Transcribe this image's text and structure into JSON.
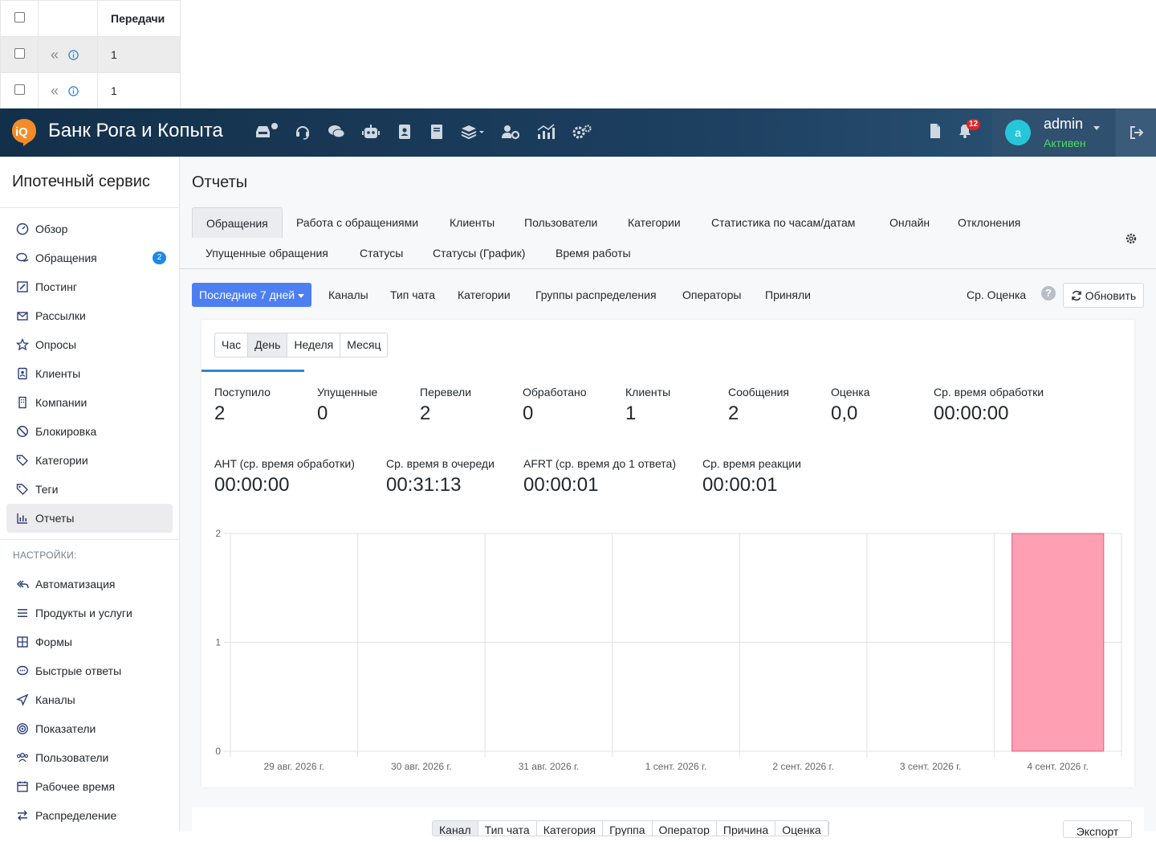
{
  "mini_table": {
    "header": "Передачи",
    "rows": [
      {
        "value": "1",
        "selected": true
      },
      {
        "value": "1",
        "selected": false
      }
    ]
  },
  "topbar": {
    "brand": "Банк Рога и Копыта",
    "logo_text": "iQ",
    "nav_icons": [
      "inbox-icon",
      "headset-icon",
      "chat-icon",
      "robot-icon",
      "contacts-icon",
      "book-icon",
      "layers-icon",
      "users-gear-icon",
      "chart-icon",
      "settings-icon"
    ],
    "notifications_count": "12",
    "user": {
      "avatar_letter": "a",
      "name": "admin",
      "status": "Активен"
    }
  },
  "sidebar": {
    "title": "Ипотечный сервис",
    "items": [
      {
        "label": "Обзор",
        "icon": "dashboard-icon"
      },
      {
        "label": "Обращения",
        "icon": "chat-icon",
        "badge": "2"
      },
      {
        "label": "Постинг",
        "icon": "edit-icon"
      },
      {
        "label": "Рассылки",
        "icon": "mail-icon"
      },
      {
        "label": "Опросы",
        "icon": "star-icon"
      },
      {
        "label": "Клиенты",
        "icon": "contact-icon"
      },
      {
        "label": "Компании",
        "icon": "building-icon"
      },
      {
        "label": "Блокировка",
        "icon": "ban-icon"
      },
      {
        "label": "Категории",
        "icon": "tags-icon"
      },
      {
        "label": "Теги",
        "icon": "tag-icon"
      },
      {
        "label": "Отчеты",
        "icon": "chart-icon",
        "active": true
      }
    ],
    "settings_label": "НАСТРОЙКИ:",
    "settings_items": [
      {
        "label": "Автоматизация",
        "icon": "reply-all-icon"
      },
      {
        "label": "Продукты и услуги",
        "icon": "list-icon"
      },
      {
        "label": "Формы",
        "icon": "table-icon"
      },
      {
        "label": "Быстрые ответы",
        "icon": "comment-icon"
      },
      {
        "label": "Каналы",
        "icon": "send-icon"
      },
      {
        "label": "Показатели",
        "icon": "target-icon"
      },
      {
        "label": "Пользователи",
        "icon": "users-icon"
      },
      {
        "label": "Рабочее время",
        "icon": "calendar-icon"
      },
      {
        "label": "Распределение",
        "icon": "exchange-icon"
      }
    ]
  },
  "main": {
    "title": "Отчеты",
    "tabs_row1": [
      "Обращения",
      "Работа с обращениями",
      "Клиенты",
      "Пользователи",
      "Категории",
      "Статистика по часам/датам",
      "Онлайн",
      "Отклонения"
    ],
    "tabs_row2": [
      "Упущенные обращения",
      "Статусы",
      "Статусы (График)",
      "Время работы"
    ],
    "filters": {
      "period": "Последние 7 дней",
      "items": [
        "Каналы",
        "Тип чата",
        "Категории",
        "Группы распределения",
        "Операторы",
        "Приняли"
      ],
      "avg_rating": "Ср. Оценка",
      "help": "?",
      "refresh": "Обновить"
    },
    "granularity": [
      "Час",
      "День",
      "Неделя",
      "Месяц"
    ],
    "granularity_selected": "День",
    "metrics_row1": [
      {
        "label": "Поступило",
        "value": "2"
      },
      {
        "label": "Упущенные",
        "value": "0"
      },
      {
        "label": "Перевели",
        "value": "2"
      },
      {
        "label": "Обработано",
        "value": "0"
      },
      {
        "label": "Клиенты",
        "value": "1"
      },
      {
        "label": "Сообщения",
        "value": "2"
      },
      {
        "label": "Оценка",
        "value": "0,0"
      },
      {
        "label": "Ср. время обработки",
        "value": "00:00:00"
      }
    ],
    "metrics_row2": [
      {
        "label": "AHT (ср. время обработки)",
        "value": "00:00:00"
      },
      {
        "label": "Ср. время в очереди",
        "value": "00:31:13"
      },
      {
        "label": "AFRT (ср. время до 1 ответа)",
        "value": "00:00:01"
      },
      {
        "label": "Ср. время реакции",
        "value": "00:00:01"
      }
    ],
    "bottom_tabs": [
      "Канал",
      "Тип чата",
      "Категория",
      "Группа",
      "Оператор",
      "Причина",
      "Оценка"
    ],
    "export": "Экспорт"
  },
  "chart_data": {
    "type": "bar",
    "categories": [
      "29 авг. 2026 г.",
      "30 авг. 2026 г.",
      "31 авг. 2026 г.",
      "1 сент. 2026 г.",
      "2 сент. 2026 г.",
      "3 сент. 2026 г.",
      "4 сент. 2026 г."
    ],
    "values": [
      0,
      0,
      0,
      0,
      0,
      0,
      2
    ],
    "yticks": [
      0,
      1,
      2
    ],
    "ylim": [
      0,
      2
    ],
    "bar_color": "#ff9fb3",
    "bar_border": "#e05b7a",
    "grid": true
  }
}
